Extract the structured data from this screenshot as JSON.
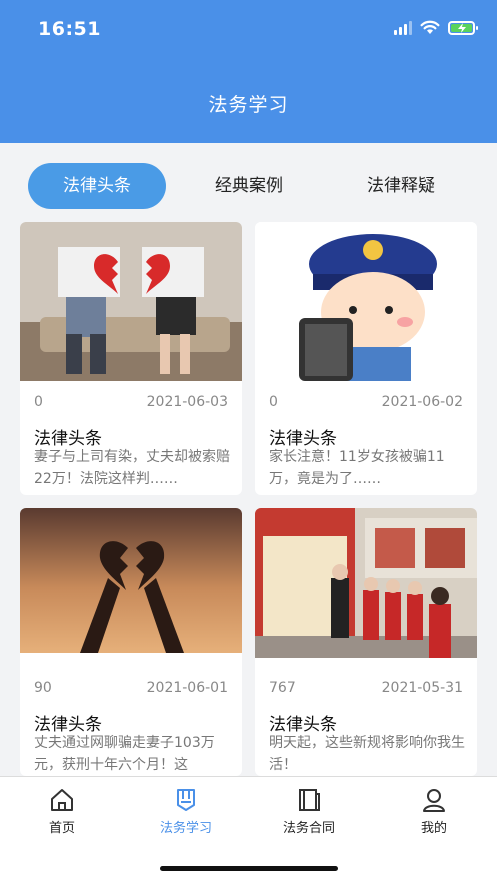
{
  "status_bar": {
    "time": "16:51"
  },
  "header": {
    "title": "法务学习"
  },
  "tabs": [
    {
      "label": "法律头条",
      "active": true
    },
    {
      "label": "经典案例",
      "active": false
    },
    {
      "label": "法律释疑",
      "active": false
    }
  ],
  "cards": [
    {
      "views": "0",
      "date": "2021-06-03",
      "title": "法律头条",
      "summary": "妻子与上司有染，丈夫却被索赔22万！法院这样判……",
      "image": "couple-broken-heart-image"
    },
    {
      "views": "0",
      "date": "2021-06-02",
      "title": "法律头条",
      "summary": "家长注意！11岁女孩被骗11万，竟是为了……",
      "image": "police-cartoon-image"
    },
    {
      "views": "90",
      "date": "2021-06-01",
      "title": "法律头条",
      "summary": "丈夫通过网聊骗走妻子103万元，获刑十年六个月！这",
      "image": "broken-heart-hands-image"
    },
    {
      "views": "767",
      "date": "2021-05-31",
      "title": "法律头条",
      "summary": "明天起，这些新规将影响你我生活！",
      "image": "school-exhibition-image"
    }
  ],
  "bottom_nav": [
    {
      "label": "首页",
      "icon": "home-icon",
      "active": false
    },
    {
      "label": "法务学习",
      "icon": "book-icon",
      "active": true
    },
    {
      "label": "法务合同",
      "icon": "document-icon",
      "active": false
    },
    {
      "label": "我的",
      "icon": "user-icon",
      "active": false
    }
  ],
  "colors": {
    "primary": "#4a90e8",
    "tab_active": "#4a9be6",
    "background": "#f2f3f5"
  }
}
